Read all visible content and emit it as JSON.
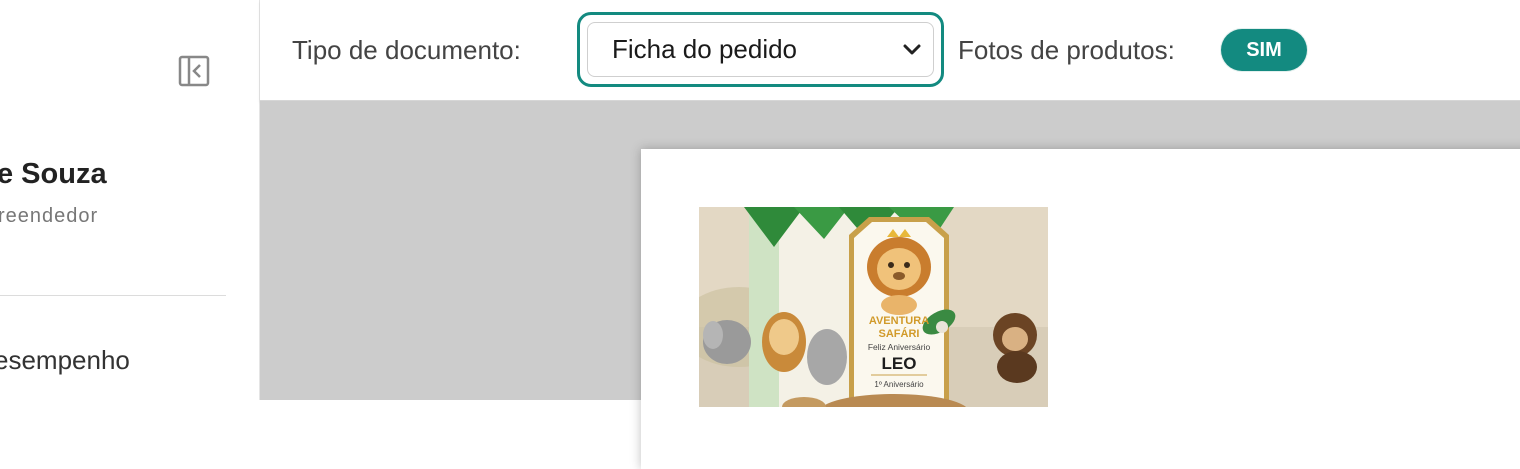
{
  "sidebar": {
    "user_name": "e Souza",
    "user_role": "reendedor",
    "nav_item_label": "esempenho",
    "collapse_icon": "sidebar-collapse-icon"
  },
  "toolbar": {
    "document_type_label": "Tipo de documento:",
    "document_type_value": "Ficha do pedido",
    "product_photos_label": "Fotos de produtos:",
    "product_photos_badge": "SIM"
  },
  "preview": {
    "photo": {
      "tag_line1": "AVENTURA",
      "tag_line2": "SAFÁRI",
      "tag_line3": "Feliz Aniversário",
      "tag_name": "LEO",
      "tag_line4": "1º Aniversário"
    }
  },
  "colors": {
    "accent": "#138a80",
    "preview_background": "#cccccc"
  }
}
